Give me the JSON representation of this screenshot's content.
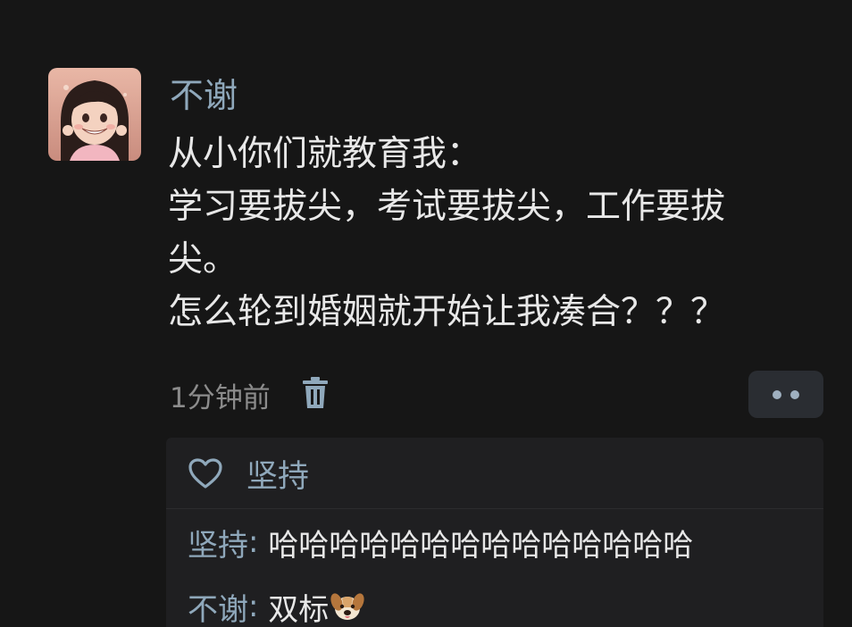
{
  "post": {
    "username": "不谢",
    "lines": [
      "从小你们就教育我：",
      "学习要拔尖，考试要拔尖，工作要拔",
      "尖。",
      "怎么轮到婚姻就开始让我凑合？？？"
    ],
    "timestamp": "1分钟前",
    "delete_icon": "trash-icon",
    "more_icon": "more-dots-icon"
  },
  "likes": {
    "icon": "heart-icon",
    "users": "坚持"
  },
  "comments": [
    {
      "author": "坚持",
      "separator": ": ",
      "text": "哈哈哈哈哈哈哈哈哈哈哈哈哈哈"
    },
    {
      "author": "不谢",
      "separator": ": ",
      "text": "双标",
      "emoji": "dog-face-emoji"
    }
  ],
  "colors": {
    "background": "#161616",
    "username": "#8fa8bb",
    "body_text": "#e8e8e8",
    "meta_text": "#8c8c8c",
    "panel": "#1f1f21"
  }
}
